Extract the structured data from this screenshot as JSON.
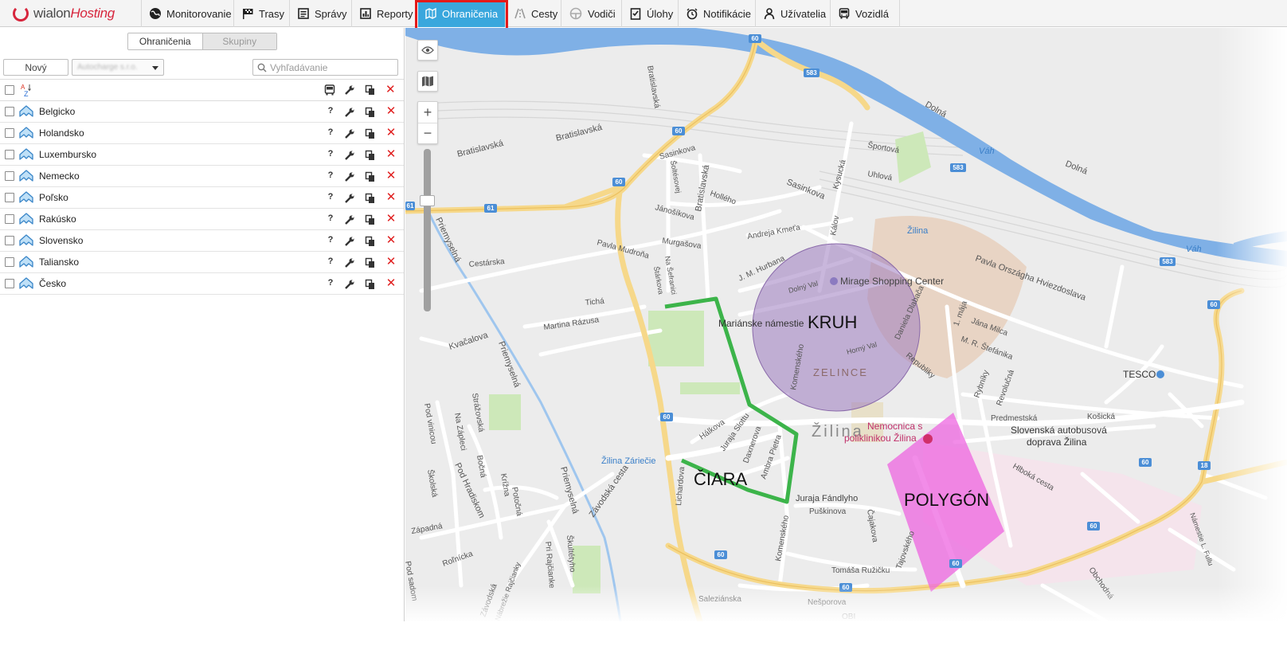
{
  "brand": {
    "part1": "wialon",
    "part2": "Hosting"
  },
  "nav": [
    {
      "id": "monitoring",
      "label": "Monitorovanie",
      "icon": "globe-icon"
    },
    {
      "id": "routes",
      "label": "Trasy",
      "icon": "flag-icon"
    },
    {
      "id": "messages",
      "label": "Správy",
      "icon": "messages-icon"
    },
    {
      "id": "reports",
      "label": "Reporty",
      "icon": "report-icon"
    },
    {
      "id": "geofences",
      "label": "Ohraničenia",
      "icon": "geofence-icon",
      "active": true
    },
    {
      "id": "trips",
      "label": "Cesty",
      "icon": "road-icon"
    },
    {
      "id": "drivers",
      "label": "Vodiči",
      "icon": "steering-wheel-icon"
    },
    {
      "id": "tasks",
      "label": "Úlohy",
      "icon": "checklist-icon"
    },
    {
      "id": "notifications",
      "label": "Notifikácie",
      "icon": "alarm-clock-icon"
    },
    {
      "id": "users",
      "label": "Užívatelia",
      "icon": "user-icon"
    },
    {
      "id": "units",
      "label": "Vozidlá",
      "icon": "bus-icon"
    }
  ],
  "left_panel": {
    "tabs": [
      {
        "label": "Ohraničenia",
        "active": true
      },
      {
        "label": "Skupiny",
        "active": false
      }
    ],
    "new_button": "Nový",
    "account_value": "Autocharge s.r.o.",
    "search_placeholder": "Vyhľadávanie",
    "sort_label": "A Z",
    "geofences": [
      {
        "name": "Belgicko"
      },
      {
        "name": "Holandsko"
      },
      {
        "name": "Luxembursko"
      },
      {
        "name": "Nemecko"
      },
      {
        "name": "Poľsko"
      },
      {
        "name": "Rakúsko"
      },
      {
        "name": "Slovensko"
      },
      {
        "name": "Taliansko"
      },
      {
        "name": "Česko"
      }
    ],
    "row_actions": {
      "info": "?",
      "edit": "wrench",
      "copy": "copy",
      "delete": "✕"
    }
  },
  "map": {
    "labels": {
      "kruh": "KRUH",
      "ciara": "ČIARA",
      "polygon": "POLYGÓN",
      "zilina": "Žilina",
      "zelince": "ZELINCE",
      "mirage": "Mirage Shopping Center",
      "marianske": "Mariánske námestie",
      "nemocnica1": "Nemocnica s",
      "nemocnica2": "poliklinikou Žilina",
      "autobus1": "Slovenská autobusová",
      "autobus2": "doprava Žilina",
      "tesco": "TESCO",
      "zilina_station": "Žilina",
      "zilina_zariecie": "Žilina Záriečie",
      "vah1": "Váh",
      "vah2": "Váh",
      "dolna1": "Dolná",
      "dolna2": "Dolná",
      "bratislavska1": "Bratislavská",
      "bratislavska2": "Bratislavská",
      "bratislavska3": "Bratislavská",
      "sasinkova": "Sasinkova",
      "sasinkova2": "Sasinkova",
      "hollého": "Hollého",
      "janosikova": "Jánošíkova",
      "murgasova": "Murgašova",
      "pavla_mudrona": "Pavla Mudroňa",
      "cestarska": "Cestárska",
      "ticha": "Tichá",
      "martina_razusa": "Martina Rázusa",
      "kvacalova": "Kvačalova",
      "priemyselna1": "Priemyselná",
      "priemyselna2": "Priemyselná",
      "priemyselna3": "Priemyselná",
      "pod_vinicou": "Pod vinicou",
      "strazovska": "Strážovská",
      "na_zapleci": "Na Zápleci",
      "bocna": "Bočná",
      "pod_hradiskom": "Pod Hradiskom",
      "skolska": "Školská",
      "krizna": "Krížna",
      "potocna": "Potočná",
      "zapadna": "Západná",
      "rolnicka": "Roľnícka",
      "zavodska_cesta": "Závodská cesta",
      "skultetyho": "Škultétyho",
      "pri_rajcianke": "Pri Rajčianke",
      "lichardova": "Lichardova",
      "halkova": "Hálkova",
      "juraja_slottu": "Juraja Slottu",
      "daxnerova": "Daxnerova",
      "ambra_pietra": "Ambra Pietra",
      "komenskeho1": "Komenského",
      "komenskeho2": "Komenského",
      "juraja_fandlyho": "Juraja Fándlyho",
      "puskinova": "Puškinova",
      "cajakova": "Čajakova",
      "tomasa_ruzicku": "Tomáša Ružičku",
      "tajovskeho": "Tajovského",
      "nesporova": "Nešporova",
      "salezianska": "Saleziánska",
      "andreja_kmeta": "Andreja Kmeťa",
      "j_m_hurbana": "J. M. Hurbana",
      "dolny_val": "Dolný Val",
      "horny_val": "Horný Val",
      "na_sefranici": "Na Šefranici",
      "starkova": "Štárkova",
      "kalov": "Kálov",
      "kysucka": "Kysucká",
      "sportova": "Športová",
      "uhlova": "Uhlová",
      "pavla_orszagha": "Pavla Országha Hviezdoslava",
      "1maja": "1. mája",
      "jana_milca": "Jána Milca",
      "mr_stefanika": "M. R. Štefánika",
      "daniela_dlabaca": "Daniela Dlabača",
      "republiky": "Republiky",
      "rybniky": "Rybníky",
      "revolucna": "Revolučná",
      "predmestska": "Predmestská",
      "kosicka": "Košická",
      "hlboka_cesta": "Hlboká cesta",
      "namestie_l_fullu": "Námestie L. Fullu",
      "obchodna": "Obchodná",
      "tesco_road": "TESCO",
      "bratislavska_col": "Bratislavská",
      "solteso": "Šoltésovej",
      "zavodska_st": "Závodská",
      "nabrezie": "Nábrežie Rajčianky",
      "pod_sadom": "Pod sadom",
      "obi": "OBI"
    },
    "shields": [
      "60",
      "60",
      "583",
      "583",
      "583",
      "60",
      "60",
      "61",
      "61",
      "60",
      "60",
      "60",
      "60",
      "60",
      "18",
      "60"
    ]
  }
}
